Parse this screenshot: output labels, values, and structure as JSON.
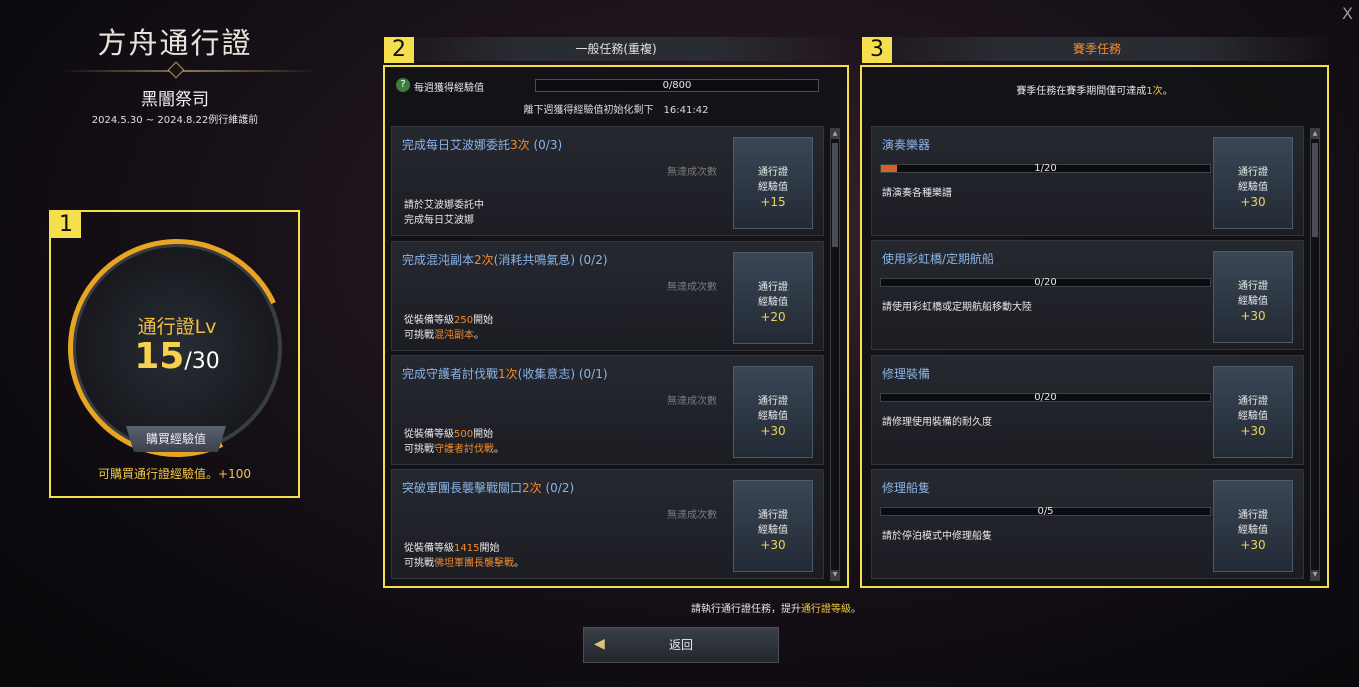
{
  "window": {
    "close_label": "X"
  },
  "left": {
    "title": "方舟通行證",
    "season_name": "黑闇祭司",
    "dates": "2024.5.30 ~ 2024.8.22例行維護前",
    "level_label": "通行證Lv",
    "level_current": "15",
    "level_max": "/30",
    "buy_button": "購買經驗值",
    "buy_note": "可購買通行證經驗值。+100",
    "box_number": "1"
  },
  "general": {
    "box_number": "2",
    "tab_label": "一般任務(重複)",
    "weekly": {
      "q_icon": "?",
      "label": "每週獲得經驗值",
      "progress_text": "0/800",
      "reset_text": "離下週獲得經驗值初始化剩下　16:41:42"
    },
    "quests": [
      {
        "title_a": "完成每日艾波娜委託",
        "count": "3次",
        "progress": " (0/3)",
        "nolimit": "無達成次數",
        "desc1": "請於艾波娜委託中",
        "desc2": "完成每日艾波娜",
        "desc1_hl": "",
        "desc2_hl": "",
        "desc1_b": "",
        "desc2_b": "",
        "reward_l1": "通行證",
        "reward_l2": "經驗值",
        "reward_xp": "+15"
      },
      {
        "title_a": "完成混沌副本",
        "count": "2次",
        "progress": "(消耗共鳴氣息) (0/2)",
        "nolimit": "無達成次數",
        "desc1": "從裝備等級",
        "desc1_hl": "250",
        "desc1_b": "開始",
        "desc2": "可挑戰",
        "desc2_hl": "混沌副本",
        "desc2_b": "。",
        "reward_l1": "通行證",
        "reward_l2": "經驗值",
        "reward_xp": "+20"
      },
      {
        "title_a": "完成守護者討伐戰",
        "count": "1次",
        "progress": "(收集意志) (0/1)",
        "nolimit": "無達成次數",
        "desc1": "從裝備等級",
        "desc1_hl": "500",
        "desc1_b": "開始",
        "desc2": "可挑戰",
        "desc2_hl": "守護者討伐戰",
        "desc2_b": "。",
        "reward_l1": "通行證",
        "reward_l2": "經驗值",
        "reward_xp": "+30"
      },
      {
        "title_a": "突破軍團長襲擊戰關口",
        "count": "2次",
        "progress": " (0/2)",
        "nolimit": "無達成次數",
        "desc1": "從裝備等級",
        "desc1_hl": "1415",
        "desc1_b": "開始",
        "desc2": "可挑戰",
        "desc2_hl": "佛坦軍團長襲擊戰",
        "desc2_b": "。",
        "reward_l1": "通行證",
        "reward_l2": "經驗值",
        "reward_xp": "+30"
      }
    ]
  },
  "season": {
    "box_number": "3",
    "tab_label": "賽季任務",
    "note_a": "賽季任務在賽季期間僅可達成",
    "note_hl": "1次",
    "note_b": "。",
    "quests": [
      {
        "title": "演奏樂器",
        "progress_text": "1/20",
        "progress": 0.05,
        "desc": "請演奏各種樂譜",
        "reward_l1": "通行證",
        "reward_l2": "經驗值",
        "reward_xp": "+30"
      },
      {
        "title": "使用彩虹橋/定期航船",
        "progress_text": "0/20",
        "progress": 0,
        "desc": "請使用彩虹橋或定期航船移動大陸",
        "reward_l1": "通行證",
        "reward_l2": "經驗值",
        "reward_xp": "+30"
      },
      {
        "title": "修理裝備",
        "progress_text": "0/20",
        "progress": 0,
        "desc": "請修理使用裝備的耐久度",
        "reward_l1": "通行證",
        "reward_l2": "經驗值",
        "reward_xp": "+30"
      },
      {
        "title": "修理船隻",
        "progress_text": "0/5",
        "progress": 0,
        "desc": "請於停泊模式中修理船隻",
        "reward_l1": "通行證",
        "reward_l2": "經驗值",
        "reward_xp": "+30"
      }
    ]
  },
  "footer": {
    "note_a": "請執行通行證任務，提升",
    "note_hl": "通行證等級",
    "note_b": "。",
    "back_button": "返回",
    "back_icon": "◀"
  },
  "colors": {
    "accent": "#f28c2b",
    "highlight": "#f5df4d",
    "title_blue": "#8ab4e8",
    "gold": "#f7d24f"
  }
}
